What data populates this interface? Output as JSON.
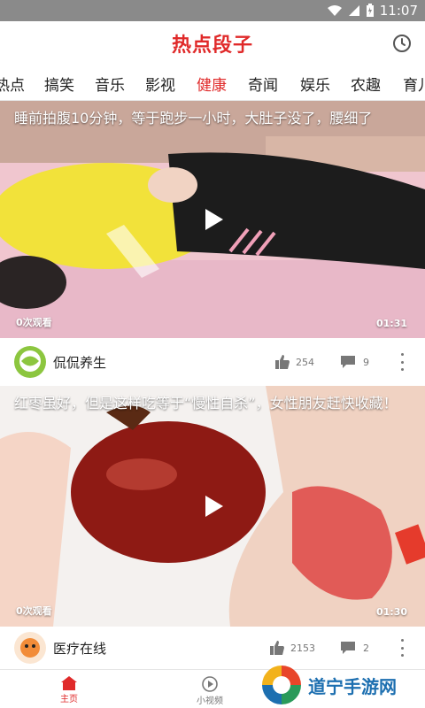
{
  "status_bar": {
    "time": "11:07"
  },
  "app": {
    "title": "热点段子"
  },
  "tabs": [
    {
      "label": "热点"
    },
    {
      "label": "搞笑"
    },
    {
      "label": "音乐"
    },
    {
      "label": "影视"
    },
    {
      "label": "健康"
    },
    {
      "label": "奇闻"
    },
    {
      "label": "娱乐"
    },
    {
      "label": "农趣"
    },
    {
      "label": "育儿"
    }
  ],
  "active_tab": "健康",
  "videos": [
    {
      "title": "睡前拍腹10分钟，等于跑步一小时，大肚子没了，腰细了",
      "views": "0次观看",
      "duration": "01:31",
      "author": "侃侃养生",
      "likes": "254",
      "comments": "9"
    },
    {
      "title": "红枣虽好，但是这样吃等于“慢性自杀”，女性朋友赶快收藏！",
      "views": "0次观看",
      "duration": "01:30",
      "author": "医疗在线",
      "likes": "2153",
      "comments": "2"
    }
  ],
  "bottom_nav": [
    {
      "label": "主页"
    },
    {
      "label": "小视频"
    }
  ],
  "watermark": {
    "text": "道宁手游网"
  },
  "colors": {
    "accent": "#e02a2a",
    "brand": "#1d6fb0"
  }
}
